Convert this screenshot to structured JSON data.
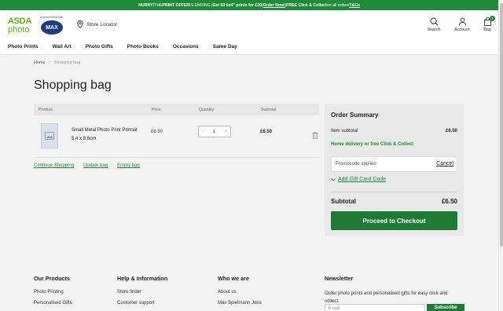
{
  "promo": {
    "hurry": "HURRY!",
    "t1": " THE ",
    "offer": "PRINT OFFER",
    "t2": " IS ENDING | ",
    "deal": "Get 50 6x4\" prints for £30",
    "t3": " | ",
    "order_now": "Order Now!",
    "t4": " | ",
    "free": "FREE Click & Collect",
    "t5": " on all orders ",
    "tcs": "T&Cs"
  },
  "header": {
    "logo_asda": "ASDA",
    "logo_photo": "photo",
    "partner_text": "In partnership with",
    "max_logo": "MAX",
    "store_locator": "Store Locator",
    "search_label": "Search",
    "account_label": "Account",
    "bag_label": "Bag",
    "bag_count": "1"
  },
  "nav": [
    "Photo Prints",
    "Wall Art",
    "Photo Gifts",
    "Photo Books",
    "Occasions",
    "Same Day"
  ],
  "breadcrumb": {
    "home": "Home",
    "separator": "/",
    "current": "Shopping bag"
  },
  "page_title": "Shopping bag",
  "bag": {
    "columns": {
      "product": "Product",
      "price": "Price",
      "quantity": "Quantity",
      "subtotal": "Subtotal"
    },
    "items": [
      {
        "name_line1": "Small Metal Photo Print Portrait",
        "name_line2": "5.4 x 8.6cm",
        "price": "£6.50",
        "quantity": "1",
        "subtotal": "£6.50"
      }
    ],
    "stepper_minus": "-",
    "stepper_plus": "+",
    "actions": {
      "continue": "Continue Shopping",
      "update": "Update bag",
      "empty": "Empty bag"
    }
  },
  "summary": {
    "heading": "Order Summary",
    "item_subtotal_label": "Item subtotal",
    "item_subtotal_value": "£6.50",
    "delivery_note": "Home delivery or free Click & Collect",
    "promocode_text": "Promocode applied",
    "cancel_label": "Cancel",
    "gift_card_label": "Add Gift Card Code",
    "subtotal_label": "Subtotal",
    "subtotal_value": "£6.50",
    "checkout_label": "Proceed to Checkout"
  },
  "footer": {
    "products": {
      "heading": "Our Products",
      "links": [
        "Photo Printing",
        "Personalised Gifts"
      ]
    },
    "help": {
      "heading": "Help & Information",
      "links": [
        "Store finder",
        "Customer support"
      ]
    },
    "who": {
      "heading": "Who we are",
      "links": [
        "About us",
        "Max Spielmann Jobs"
      ]
    },
    "newsletter": {
      "heading": "Newsletter",
      "text": "Order photo prints and personalised gifts for easy click and collect.",
      "email_placeholder": "E-mail",
      "subscribe_label": "Subscribe"
    }
  },
  "colors": {
    "brand_green": "#1f8a3a",
    "asda_green": "#68a51c",
    "max_blue": "#1f3d7a"
  }
}
